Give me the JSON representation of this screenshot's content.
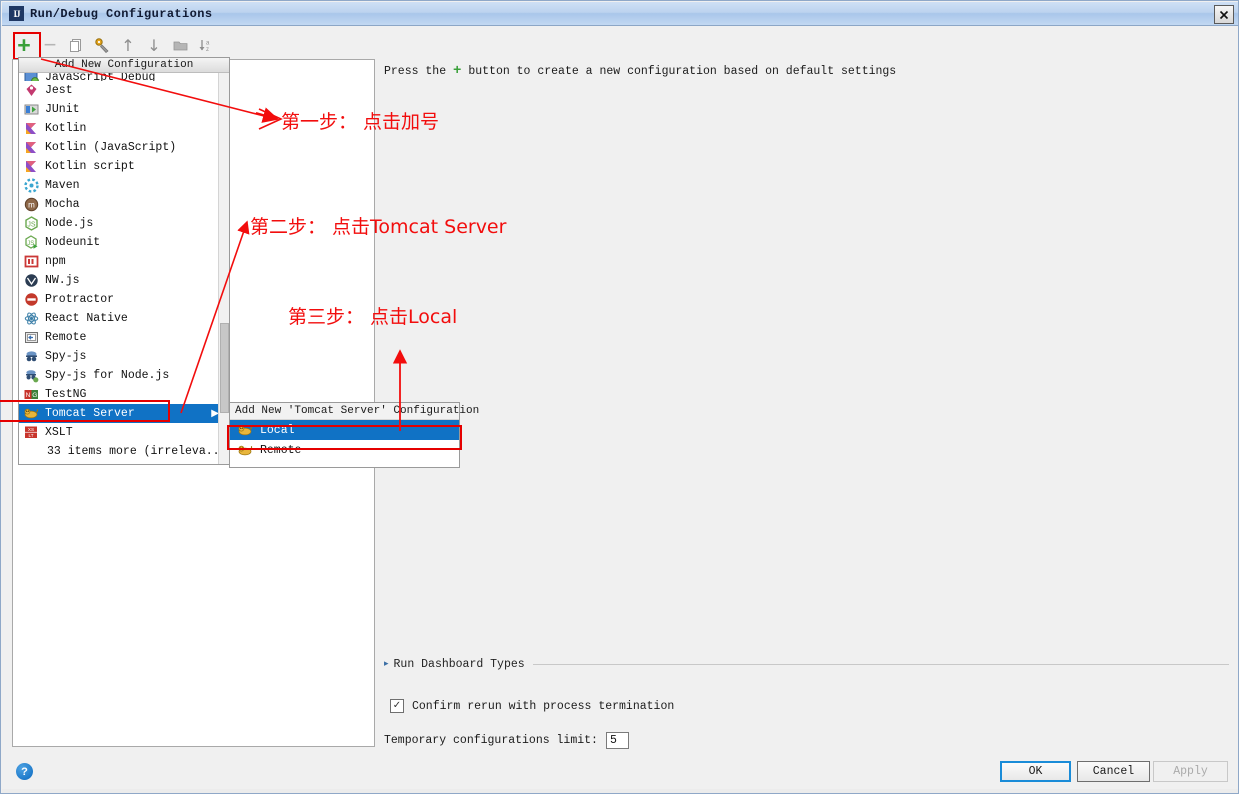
{
  "window": {
    "title": "Run/Debug Configurations",
    "logo_text": "IJ",
    "close_label": "✕"
  },
  "toolbar": {
    "items": [
      {
        "name": "add-configuration-button",
        "glyph": "+",
        "style": "plus"
      },
      {
        "name": "remove-configuration-button",
        "glyph": "−",
        "style": "minus"
      },
      {
        "name": "copy-configuration-button",
        "glyph": "❐",
        "style": "gray"
      },
      {
        "name": "edit-templates-button",
        "glyph": "⚒",
        "style": "gray"
      },
      {
        "name": "move-up-button",
        "glyph": "↑",
        "style": "arrow"
      },
      {
        "name": "move-down-button",
        "glyph": "↓",
        "style": "arrow"
      },
      {
        "name": "folder-button",
        "glyph": "▬",
        "style": "gray"
      },
      {
        "name": "sort-alphabetically-button",
        "glyph": "↓ᵃᶠ",
        "style": "arrow"
      }
    ]
  },
  "hint": {
    "prefix": "Press the",
    "plus": "+",
    "suffix": "button to create a new configuration based on default settings"
  },
  "popup": {
    "header": "Add New Configuration",
    "items": [
      {
        "label": "JavaScript Debug",
        "icon": "javascript-debug-icon",
        "partial": true
      },
      {
        "label": "Jest",
        "icon": "jest-icon"
      },
      {
        "label": "JUnit",
        "icon": "junit-icon"
      },
      {
        "label": "Kotlin",
        "icon": "kotlin-icon"
      },
      {
        "label": "Kotlin (JavaScript)",
        "icon": "kotlin-js-icon"
      },
      {
        "label": "Kotlin script",
        "icon": "kotlin-script-icon"
      },
      {
        "label": "Maven",
        "icon": "maven-icon"
      },
      {
        "label": "Mocha",
        "icon": "mocha-icon"
      },
      {
        "label": "Node.js",
        "icon": "nodejs-icon"
      },
      {
        "label": "Nodeunit",
        "icon": "nodeunit-icon"
      },
      {
        "label": "npm",
        "icon": "npm-icon"
      },
      {
        "label": "NW.js",
        "icon": "nwjs-icon"
      },
      {
        "label": "Protractor",
        "icon": "protractor-icon"
      },
      {
        "label": "React Native",
        "icon": "react-native-icon"
      },
      {
        "label": "Remote",
        "icon": "remote-icon"
      },
      {
        "label": "Spy-js",
        "icon": "spyjs-icon"
      },
      {
        "label": "Spy-js for Node.js",
        "icon": "spyjs-node-icon"
      },
      {
        "label": "TestNG",
        "icon": "testng-icon"
      },
      {
        "label": "Tomcat Server",
        "icon": "tomcat-icon",
        "selected": true,
        "submenu": true,
        "arrow": "▶"
      },
      {
        "label": "XSLT",
        "icon": "xslt-icon"
      },
      {
        "label": "33 items more (irreleva...",
        "icon": "",
        "more": true
      }
    ]
  },
  "submenu": {
    "header": "Add New 'Tomcat Server' Configuration",
    "items": [
      {
        "label": "Local",
        "icon": "tomcat-icon",
        "selected": true
      },
      {
        "label": "Remote",
        "icon": "tomcat-icon",
        "selected": false
      }
    ]
  },
  "form": {
    "run_dashboard_types": "Run Dashboard Types",
    "confirm_rerun_label": "Confirm rerun with process termination",
    "confirm_rerun_checked": true,
    "confirm_rerun_glyph": "✓",
    "temp_limit_label": "Temporary configurations limit:",
    "temp_limit_value": "5"
  },
  "footer": {
    "help_glyph": "?",
    "ok": "OK",
    "cancel": "Cancel",
    "apply": "Apply"
  },
  "annotations": [
    {
      "text": "第一步： 点击加号"
    },
    {
      "text": "第二步： 点击Tomcat Server"
    },
    {
      "text": "第三步： 点击Local"
    }
  ],
  "colors": {
    "selection_blue": "#1072c5",
    "annotation_red": "#f20d0d",
    "plus_green": "#3aa03a",
    "title_blue": "#a9c6ea"
  }
}
